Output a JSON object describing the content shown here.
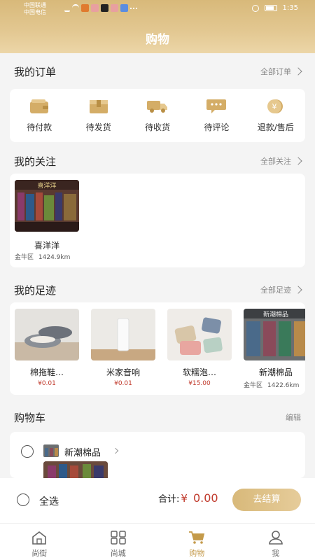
{
  "status_bar": {
    "carrier_1": "中国联通",
    "carrier_2": "中国电信",
    "time": "1:35"
  },
  "header": {
    "title": "购物"
  },
  "orders": {
    "title": "我的订单",
    "link": "全部订单",
    "items": [
      {
        "label": "待付款",
        "icon": "wallet-icon"
      },
      {
        "label": "待发货",
        "icon": "package-icon"
      },
      {
        "label": "待收货",
        "icon": "truck-icon"
      },
      {
        "label": "待评论",
        "icon": "comment-icon"
      },
      {
        "label": "退款/售后",
        "icon": "refund-icon"
      }
    ]
  },
  "follow": {
    "title": "我的关注",
    "link": "全部关注",
    "shop": {
      "name": "喜洋洋",
      "district": "金牛区",
      "distance": "1424.9km",
      "sign": "喜洋洋"
    }
  },
  "tracks": {
    "title": "我的足迹",
    "link": "全部足迹",
    "items": [
      {
        "name": "棉拖鞋…",
        "price": "¥0.01"
      },
      {
        "name": "米家音响",
        "price": "¥0.01"
      },
      {
        "name": "软糯泡…",
        "price": "¥15.00"
      },
      {
        "name": "新潮棉品",
        "district": "金牛区",
        "distance": "1422.6km",
        "sign": "新潮棉品"
      }
    ]
  },
  "cart": {
    "title": "购物车",
    "edit": "编辑",
    "store_name": "新潮棉品"
  },
  "bottom": {
    "select_all": "全选",
    "total_label": "合计:",
    "currency": "¥",
    "total_value": "0.00",
    "checkout": "去结算"
  },
  "tabbar": {
    "items": [
      {
        "label": "尚街",
        "icon": "home-icon"
      },
      {
        "label": "尚城",
        "icon": "grid-icon"
      },
      {
        "label": "购物",
        "icon": "cart-icon",
        "active": true
      },
      {
        "label": "我",
        "icon": "user-icon"
      }
    ]
  },
  "colors": {
    "accent": "#d8b97a",
    "price": "#c0392b",
    "active_tab": "#c49a4a"
  }
}
